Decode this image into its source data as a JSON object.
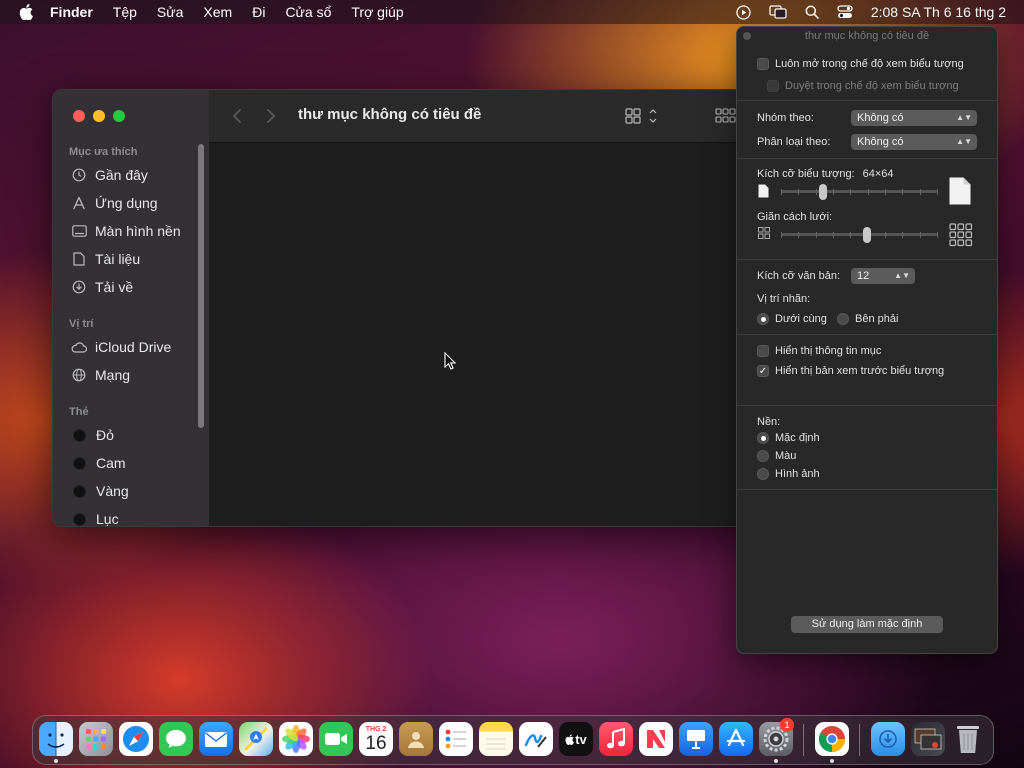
{
  "menubar": {
    "app": "Finder",
    "items": [
      "Tệp",
      "Sửa",
      "Xem",
      "Đi",
      "Cửa sổ",
      "Trợ giúp"
    ],
    "clock": "2:08 SA Th 6 16 thg 2"
  },
  "finder": {
    "title": "thư mục không có tiêu đề",
    "sidebar": {
      "favorites_header": "Mục ưa thích",
      "favorites": [
        "Gần đây",
        "Ứng dụng",
        "Màn hình nền",
        "Tài liệu",
        "Tải về"
      ],
      "locations_header": "Vị trí",
      "locations": [
        "iCloud Drive",
        "Mạng"
      ],
      "tags_header": "Thẻ",
      "tags": [
        "Đỏ",
        "Cam",
        "Vàng",
        "Lục"
      ]
    }
  },
  "panel": {
    "title": "thư mục không có tiêu đề",
    "always_open": "Luôn mở trong chế độ xem biểu tượng",
    "browse": "Duyệt trong chế độ xem biểu tượng",
    "group_by_label": "Nhóm theo:",
    "group_by_value": "Không có",
    "sort_by_label": "Phân loại theo:",
    "sort_by_value": "Không có",
    "icon_size_label": "Kích cỡ biểu tượng:",
    "icon_size_value": "64×64",
    "icon_size_level": 0.27,
    "grid_spacing_label": "Giãn cách lưới:",
    "grid_spacing_level": 0.55,
    "text_size_label": "Kích cỡ văn bản:",
    "text_size_value": "12",
    "label_pos_label": "Vị trí nhãn:",
    "label_bottom": "Dưới cùng",
    "label_right": "Bên phải",
    "show_item_info": "Hiển thị thông tin mục",
    "show_preview": "Hiển thị bản xem trước biểu tượng",
    "background_label": "Nền:",
    "bg_default": "Mặc định",
    "bg_color": "Màu",
    "bg_picture": "Hình ảnh",
    "use_default_button": "Sử dụng làm mặc định"
  },
  "dock": {
    "calendar_month": "THG 2",
    "calendar_day": "16",
    "tv_label": "tv",
    "settings_badge": "1"
  }
}
